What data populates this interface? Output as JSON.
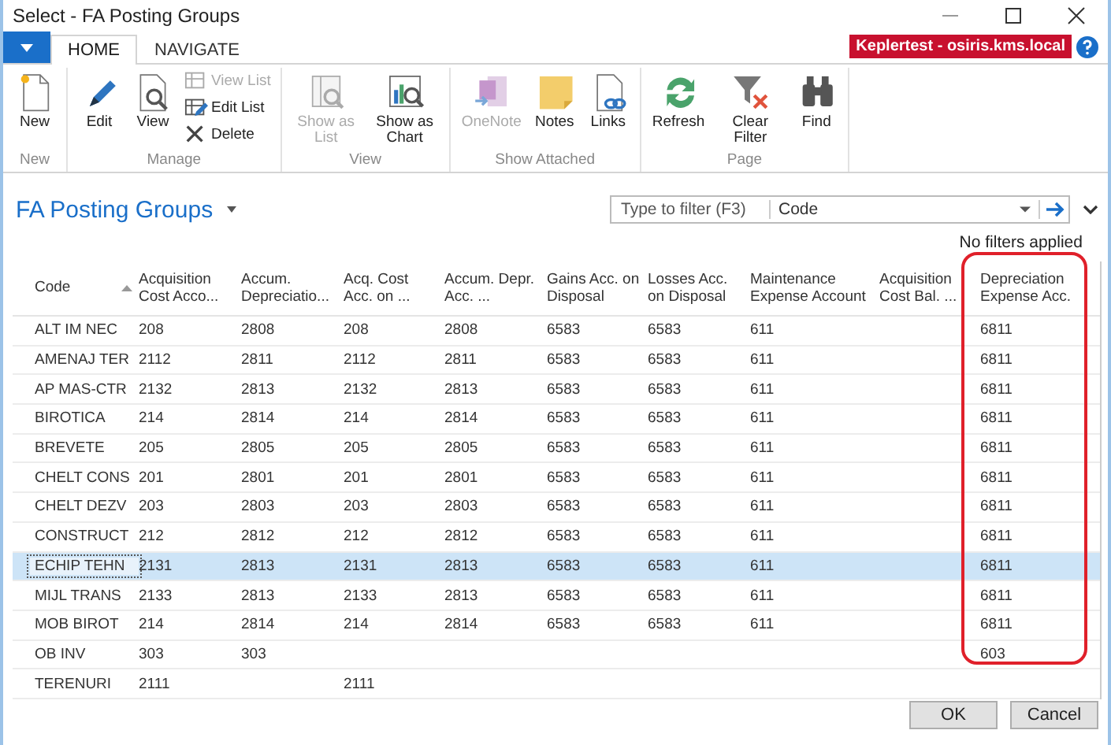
{
  "window": {
    "title": "Select - FA Posting Groups"
  },
  "ribbon": {
    "tabs": [
      {
        "label": "HOME",
        "selected": true
      },
      {
        "label": "NAVIGATE",
        "selected": false
      }
    ],
    "server_badge": "Keplertest - osiris.kms.local",
    "groups": [
      {
        "label": "New",
        "buttons": [
          {
            "label": "New",
            "kind": "large",
            "disabled": false
          }
        ]
      },
      {
        "label": "Manage",
        "buttons": [
          {
            "label": "Edit",
            "kind": "large",
            "disabled": false
          },
          {
            "label": "View",
            "kind": "large",
            "disabled": false
          },
          {
            "label": "View List",
            "kind": "small",
            "disabled": true
          },
          {
            "label": "Edit List",
            "kind": "small",
            "disabled": false
          },
          {
            "label": "Delete",
            "kind": "small",
            "disabled": false
          }
        ]
      },
      {
        "label": "View",
        "buttons": [
          {
            "label": "Show as List",
            "kind": "large",
            "disabled": true
          },
          {
            "label": "Show as Chart",
            "kind": "large",
            "disabled": false
          }
        ]
      },
      {
        "label": "Show Attached",
        "buttons": [
          {
            "label": "OneNote",
            "kind": "large",
            "disabled": true
          },
          {
            "label": "Notes",
            "kind": "large",
            "disabled": false
          },
          {
            "label": "Links",
            "kind": "large",
            "disabled": false
          }
        ]
      },
      {
        "label": "Page",
        "buttons": [
          {
            "label": "Refresh",
            "kind": "large",
            "disabled": false
          },
          {
            "label": "Clear Filter",
            "kind": "large",
            "disabled": false
          },
          {
            "label": "Find",
            "kind": "large",
            "disabled": false
          }
        ]
      }
    ]
  },
  "page": {
    "title": "FA Posting Groups",
    "filter": {
      "placeholder": "Type to filter (F3)",
      "field": "Code"
    },
    "filter_status": "No filters applied"
  },
  "table": {
    "columns": [
      {
        "label": "Code",
        "sorted": true
      },
      {
        "label": "Acquisition Cost Acco...",
        "sorted": false
      },
      {
        "label": "Accum. Depreciatio...",
        "sorted": false
      },
      {
        "label": "Acq. Cost Acc. on ...",
        "sorted": false
      },
      {
        "label": "Accum. Depr. Acc. ...",
        "sorted": false
      },
      {
        "label": "Gains Acc. on Disposal",
        "sorted": false
      },
      {
        "label": "Losses Acc. on Disposal",
        "sorted": false
      },
      {
        "label": "Maintenance Expense Account",
        "sorted": false
      },
      {
        "label": "Acquisition Cost Bal. ...",
        "sorted": false
      },
      {
        "label": "Depreciation Expense Acc.",
        "sorted": false
      }
    ],
    "rows": [
      {
        "selected": false,
        "cells": [
          "ALT IM NEC",
          "208",
          "2808",
          "208",
          "2808",
          "6583",
          "6583",
          "611",
          null,
          "6811"
        ]
      },
      {
        "selected": false,
        "cells": [
          "AMENAJ TER",
          "2112",
          "2811",
          "2112",
          "2811",
          "6583",
          "6583",
          "611",
          null,
          "6811"
        ]
      },
      {
        "selected": false,
        "cells": [
          "AP MAS-CTR",
          "2132",
          "2813",
          "2132",
          "2813",
          "6583",
          "6583",
          "611",
          null,
          "6811"
        ]
      },
      {
        "selected": false,
        "cells": [
          "BIROTICA",
          "214",
          "2814",
          "214",
          "2814",
          "6583",
          "6583",
          "611",
          null,
          "6811"
        ]
      },
      {
        "selected": false,
        "cells": [
          "BREVETE",
          "205",
          "2805",
          "205",
          "2805",
          "6583",
          "6583",
          "611",
          null,
          "6811"
        ]
      },
      {
        "selected": false,
        "cells": [
          "CHELT CONS",
          "201",
          "2801",
          "201",
          "2801",
          "6583",
          "6583",
          "611",
          null,
          "6811"
        ]
      },
      {
        "selected": false,
        "cells": [
          "CHELT DEZV",
          "203",
          "2803",
          "203",
          "2803",
          "6583",
          "6583",
          "611",
          null,
          "6811"
        ]
      },
      {
        "selected": false,
        "cells": [
          "CONSTRUCT",
          "212",
          "2812",
          "212",
          "2812",
          "6583",
          "6583",
          "611",
          null,
          "6811"
        ]
      },
      {
        "selected": true,
        "cells": [
          "ECHIP TEHN",
          "2131",
          "2813",
          "2131",
          "2813",
          "6583",
          "6583",
          "611",
          null,
          "6811"
        ]
      },
      {
        "selected": false,
        "cells": [
          "MIJL TRANS",
          "2133",
          "2813",
          "2133",
          "2813",
          "6583",
          "6583",
          "611",
          null,
          "6811"
        ]
      },
      {
        "selected": false,
        "cells": [
          "MOB BIROT",
          "214",
          "2814",
          "214",
          "2814",
          "6583",
          "6583",
          "611",
          null,
          "6811"
        ]
      },
      {
        "selected": false,
        "cells": [
          "OB INV",
          "303",
          "303",
          null,
          null,
          null,
          null,
          null,
          null,
          "603"
        ]
      },
      {
        "selected": false,
        "cells": [
          "TERENURI",
          "2111",
          null,
          "2111",
          null,
          null,
          null,
          null,
          null,
          null
        ]
      }
    ]
  },
  "buttons": [
    "OK",
    "Cancel"
  ]
}
